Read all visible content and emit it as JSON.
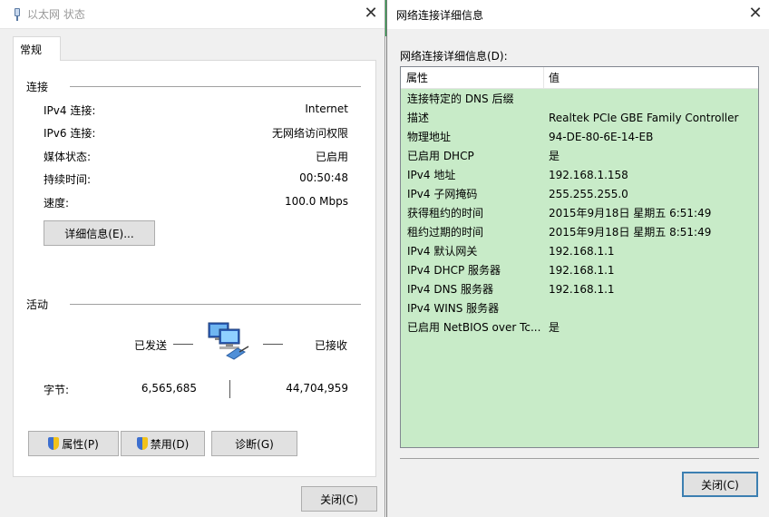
{
  "left_window": {
    "title": "以太网 状态",
    "close_glyph": "✕",
    "tab_label": "常规",
    "connection": {
      "group_title": "连接",
      "rows": [
        {
          "label": "IPv4 连接:",
          "value": "Internet"
        },
        {
          "label": "IPv6 连接:",
          "value": "无网络访问权限"
        },
        {
          "label": "媒体状态:",
          "value": "已启用"
        },
        {
          "label": "持续时间:",
          "value": "00:50:48"
        },
        {
          "label": "速度:",
          "value": "100.0 Mbps"
        }
      ],
      "details_button": "详细信息(E)..."
    },
    "activity": {
      "group_title": "活动",
      "sent_label": "已发送",
      "received_label": "已接收",
      "bytes_label": "字节:",
      "bytes_sent": "6,565,685",
      "bytes_received": "44,704,959"
    },
    "buttons": {
      "properties": "属性(P)",
      "disable": "禁用(D)",
      "diagnose": "诊断(G)",
      "close": "关闭(C)"
    }
  },
  "right_window": {
    "title": "网络连接详细信息",
    "close_glyph": "✕",
    "list_label": "网络连接详细信息(D):",
    "columns": {
      "property": "属性",
      "value": "值"
    },
    "rows": [
      {
        "property": "连接特定的 DNS 后缀",
        "value": ""
      },
      {
        "property": "描述",
        "value": "Realtek PCIe GBE Family Controller"
      },
      {
        "property": "物理地址",
        "value": "94-DE-80-6E-14-EB"
      },
      {
        "property": "已启用 DHCP",
        "value": "是"
      },
      {
        "property": "IPv4 地址",
        "value": "192.168.1.158"
      },
      {
        "property": "IPv4 子网掩码",
        "value": "255.255.255.0"
      },
      {
        "property": "获得租约的时间",
        "value": "2015年9月18日 星期五 6:51:49"
      },
      {
        "property": "租约过期的时间",
        "value": "2015年9月18日 星期五 8:51:49"
      },
      {
        "property": "IPv4 默认网关",
        "value": "192.168.1.1"
      },
      {
        "property": "IPv4 DHCP 服务器",
        "value": "192.168.1.1"
      },
      {
        "property": "IPv4 DNS 服务器",
        "value": "192.168.1.1"
      },
      {
        "property": "IPv4 WINS 服务器",
        "value": ""
      },
      {
        "property": "已启用 NetBIOS over Tc...",
        "value": "是"
      }
    ],
    "close_button": "关闭(C)"
  },
  "colors": {
    "list_background": "#c8ebc8",
    "button_focus": "#3c7fb1",
    "window_background": "#f0f0f0"
  }
}
